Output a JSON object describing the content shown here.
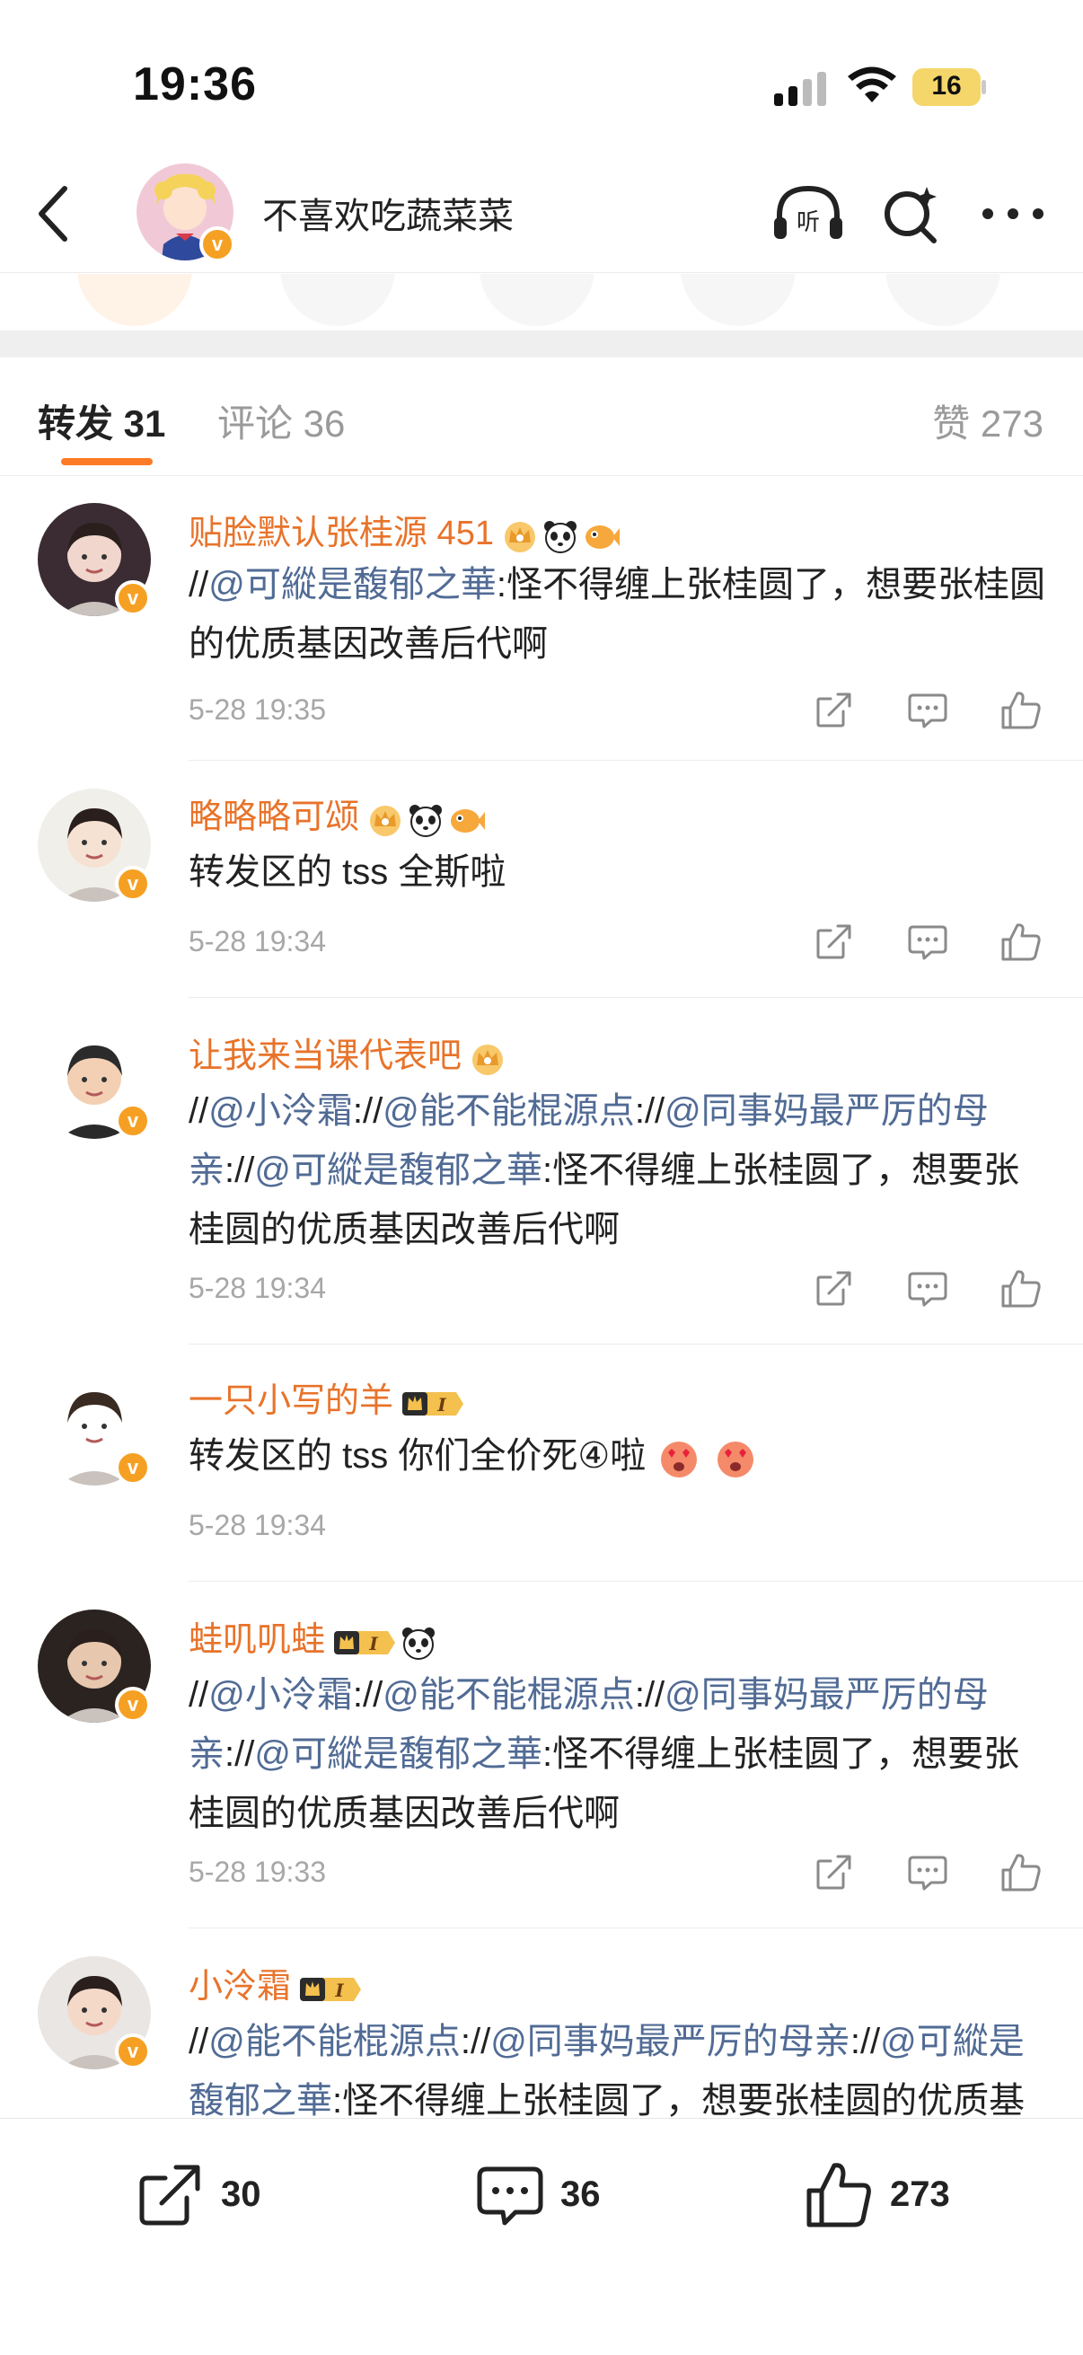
{
  "status": {
    "time": "19:36",
    "battery": "16"
  },
  "header": {
    "user_name": "不喜欢吃蔬菜菜"
  },
  "tabs": {
    "repost": "转发 31",
    "comment": "评论 36",
    "likes": "赞 273"
  },
  "items": [
    {
      "name": "贴脸默认张桂源 451",
      "segments": [
        [
          "t",
          "//"
        ],
        [
          "m",
          "@可縱是馥郁之華"
        ],
        [
          "t",
          ":怪不得缠上张桂圆了，想要张桂圆的优质基因改善后代啊"
        ]
      ],
      "time": "5-28 19:35"
    },
    {
      "name": "略略略可颂",
      "segments": [
        [
          "t",
          "转发区的 tss 全斯啦"
        ]
      ],
      "time": "5-28 19:34"
    },
    {
      "name": "让我来当课代表吧",
      "segments": [
        [
          "t",
          "//"
        ],
        [
          "m",
          "@小泠霜"
        ],
        [
          "t",
          ":"
        ],
        [
          "t",
          "//"
        ],
        [
          "m",
          "@能不能棍源点"
        ],
        [
          "t",
          ":"
        ],
        [
          "t",
          "//"
        ],
        [
          "m",
          "@同事妈最严厉的母亲"
        ],
        [
          "t",
          ":"
        ],
        [
          "t",
          "//"
        ],
        [
          "m",
          "@可縱是馥郁之華"
        ],
        [
          "t",
          ":怪不得缠上张桂圆了，想要张桂圆的优质基因改善后代啊"
        ]
      ],
      "time": "5-28 19:34"
    },
    {
      "name": "一只小写的羊",
      "segments": [
        [
          "t",
          "转发区的 tss 你们全价死④啦"
        ]
      ],
      "time": "5-28 19:34"
    },
    {
      "name": "蛙叽叽蛙",
      "segments": [
        [
          "t",
          "//"
        ],
        [
          "m",
          "@小泠霜"
        ],
        [
          "t",
          ":"
        ],
        [
          "t",
          "//"
        ],
        [
          "m",
          "@能不能棍源点"
        ],
        [
          "t",
          ":"
        ],
        [
          "t",
          "//"
        ],
        [
          "m",
          "@同事妈最严厉的母亲"
        ],
        [
          "t",
          ":"
        ],
        [
          "t",
          "//"
        ],
        [
          "m",
          "@可縱是馥郁之華"
        ],
        [
          "t",
          ":怪不得缠上张桂圆了，想要张桂圆的优质基因改善后代啊"
        ]
      ],
      "time": "5-28 19:33"
    },
    {
      "name": "小泠霜",
      "segments": [
        [
          "t",
          "//"
        ],
        [
          "m",
          "@能不能棍源点"
        ],
        [
          "t",
          ":"
        ],
        [
          "t",
          "//"
        ],
        [
          "m",
          "@同事妈最严厉的母亲"
        ],
        [
          "t",
          ":"
        ],
        [
          "t",
          "//"
        ],
        [
          "m",
          "@可縱是馥郁之華"
        ],
        [
          "t",
          ":怪不得缠上张桂圆了，想要张桂圆的优质基因改善后代啊"
        ]
      ],
      "time": ""
    }
  ],
  "toolbar": {
    "repost_count": "30",
    "comment_count": "36",
    "like_count": "273"
  },
  "icons": {
    "back": "chevron-left-icon",
    "listen": "headphones-icon",
    "search": "search-sparkle-icon",
    "more": "more-dots-icon",
    "share": "share-icon",
    "comment": "comment-icon",
    "like": "thumbs-up-icon"
  },
  "colors": {
    "accent": "#ff7a26",
    "username": "#e8732a",
    "mention": "#516b95",
    "verified": "#f6a023"
  }
}
